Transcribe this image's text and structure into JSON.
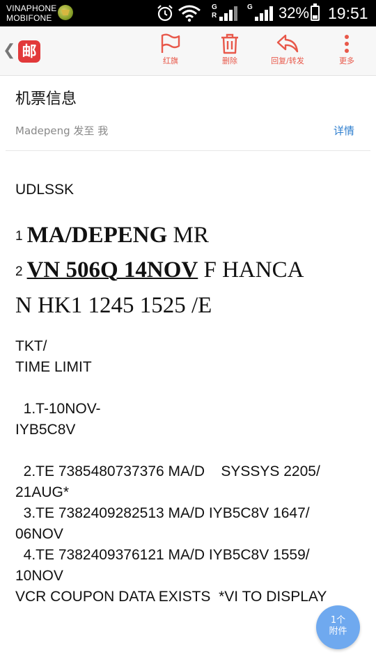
{
  "status_bar": {
    "carrier1": "VINAPHONE",
    "carrier2": "MOBIFONE",
    "network1": "G",
    "network1b": "R",
    "network2": "G",
    "battery": "32%",
    "time": "19:51"
  },
  "toolbar": {
    "back_icon": "chevron-left",
    "app_logo": "邮",
    "flag_label": "红旗",
    "delete_label": "删除",
    "reply_label": "回复/转发",
    "more_label": "更多",
    "accent_color": "#e8584a"
  },
  "email": {
    "subject": "机票信息",
    "sender": "Madepeng 发至 我",
    "details_link": "详情",
    "body": {
      "line1": "UDLSSK",
      "pnr_num1": "1",
      "passenger_name": "MA/DEPENG",
      "passenger_title": " MR",
      "pnr_num2": "2",
      "flight": "VN 506Q 14NOV",
      "flight_rest": " F HANCA",
      "flight_line2": "N HK1  1245  1525  /E",
      "tkt": "TKT/",
      "time_limit": "TIME LIMIT",
      "tl1a": "  1.T-10NOV-",
      "tl1b": "IYB5C8V",
      "te2a": "  2.TE 7385480737376 MA/D    SYSSYS 2205/",
      "te2b": "21AUG*",
      "te3a": "  3.TE 7382409282513 MA/D IYB5C8V 1647/",
      "te3b": "06NOV",
      "te4a": "  4.TE 7382409376121 MA/D IYB5C8V 1559/",
      "te4b": "10NOV",
      "vcr": "VCR COUPON DATA EXISTS  *VI TO DISPLAY"
    }
  },
  "attachment": {
    "count": "1个",
    "label": "附件",
    "color": "#6fa9ef"
  }
}
